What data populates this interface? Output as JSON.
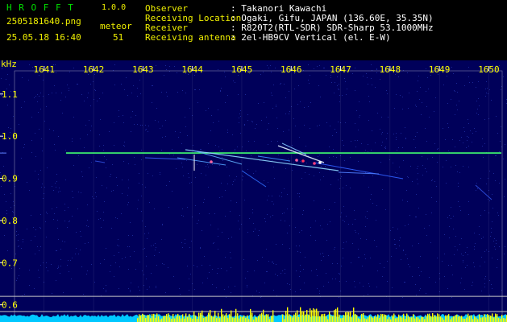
{
  "header": {
    "app_name": "H R O F F T",
    "version": "1.0.0",
    "file_name": "2505181640.png",
    "datetime": "25.05.18 16:40",
    "meteor_label": "meteor",
    "meteor_count": "51",
    "fields": [
      {
        "label": "Observer",
        "value": ": Takanori Kawachi"
      },
      {
        "label": "Receiving Location",
        "value": ": Ogaki, Gifu, JAPAN (136.60E, 35.35N)"
      },
      {
        "label": "Receiver",
        "value": ": R820T2(RTL-SDR) SDR-Sharp 53.1000MHz"
      },
      {
        "label": "Receiving antenna",
        "value": ": 2el-HB9CV Vertical (el. E-W)"
      }
    ]
  },
  "colors": {
    "background": "#000000",
    "spectrogram_base": "#00005a",
    "grid": "#ffffff",
    "header_green": "#00e000",
    "header_yellow": "#f0f000",
    "signal_line": "#40ff70",
    "meteor_trace": "#ffffff",
    "level_bars": "#ffff00",
    "level_fill": "#00c8ff"
  },
  "chart_data": {
    "type": "heatmap",
    "x_unit": "s",
    "x_ticks": [
      "1641",
      "1642",
      "1643",
      "1644",
      "1645",
      "1646",
      "1647",
      "1648",
      "1649",
      "1650"
    ],
    "xlim": [
      1640.4,
      1650.27
    ],
    "y_unit": "kHz",
    "y_ticks": [
      "1.1",
      "1.0",
      "0.9",
      "0.8",
      "0.7",
      "0.6"
    ],
    "ylim": [
      0.563,
      1.155
    ],
    "carrier_khz": 0.96,
    "level_threshold_khz": 0.62
  }
}
